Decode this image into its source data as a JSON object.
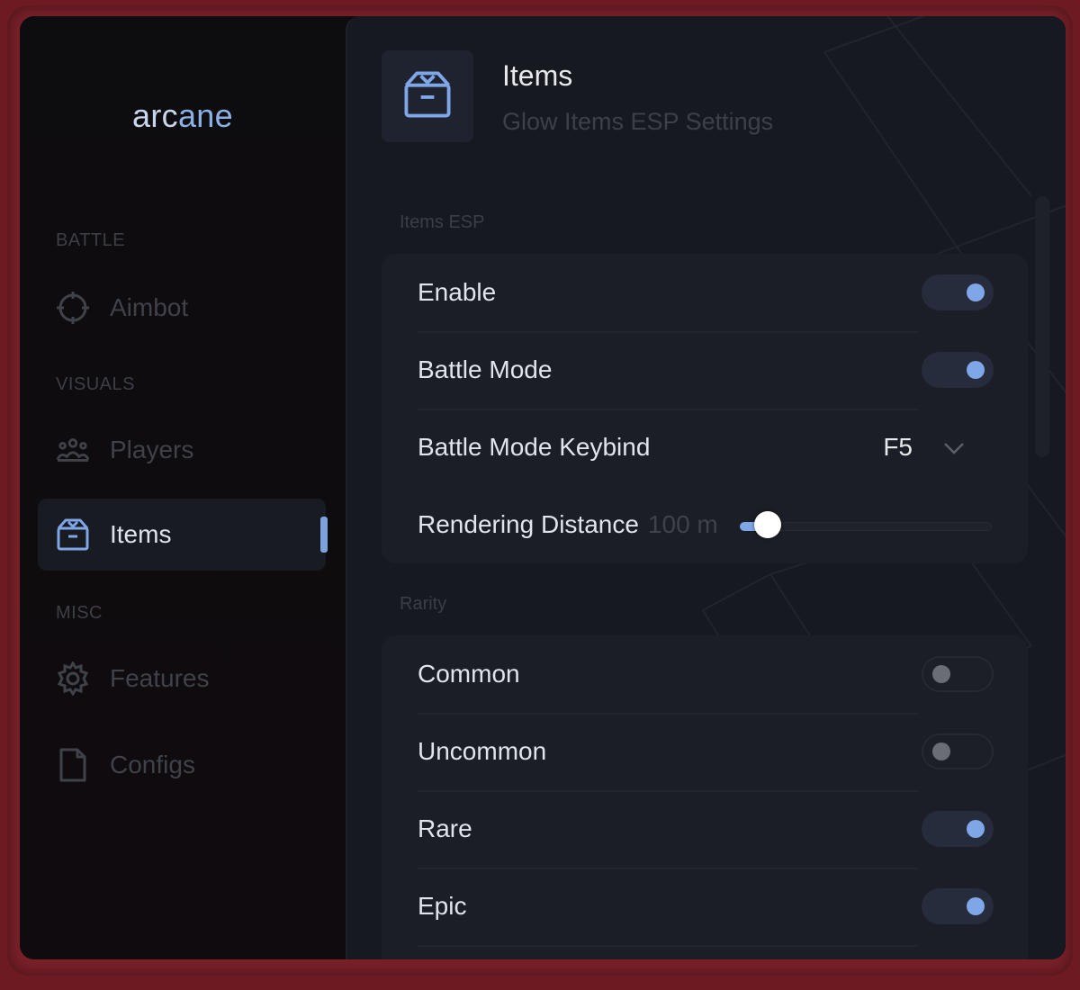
{
  "app": {
    "logo_prefix": "arc",
    "logo_suffix": "ane",
    "accent_color": "#7fa6e6"
  },
  "sidebar": {
    "sections": [
      {
        "label": "BATTLE",
        "items": [
          {
            "label": "Aimbot",
            "icon": "crosshair-icon"
          }
        ]
      },
      {
        "label": "VISUALS",
        "items": [
          {
            "label": "Players",
            "icon": "users-icon"
          },
          {
            "label": "Items",
            "icon": "box-icon",
            "active": true
          }
        ]
      },
      {
        "label": "MISC",
        "items": [
          {
            "label": "Features",
            "icon": "gear-icon"
          },
          {
            "label": "Configs",
            "icon": "file-icon"
          }
        ]
      }
    ]
  },
  "header": {
    "title": "Items",
    "subtitle": "Glow Items ESP Settings",
    "icon": "box-icon"
  },
  "items_esp": {
    "label": "Items ESP",
    "enable": {
      "label": "Enable",
      "on": true
    },
    "battle_mode": {
      "label": "Battle Mode",
      "on": true
    },
    "battle_mode_keybind": {
      "label": "Battle Mode Keybind",
      "value": "F5"
    },
    "rendering_distance": {
      "label": "Rendering Distance",
      "value_text": "100 m",
      "fraction": 0.1
    }
  },
  "rarity": {
    "label": "Rarity",
    "common": {
      "label": "Common",
      "on": false
    },
    "uncommon": {
      "label": "Uncommon",
      "on": false
    },
    "rare": {
      "label": "Rare",
      "on": true
    },
    "epic": {
      "label": "Epic",
      "on": true
    }
  }
}
